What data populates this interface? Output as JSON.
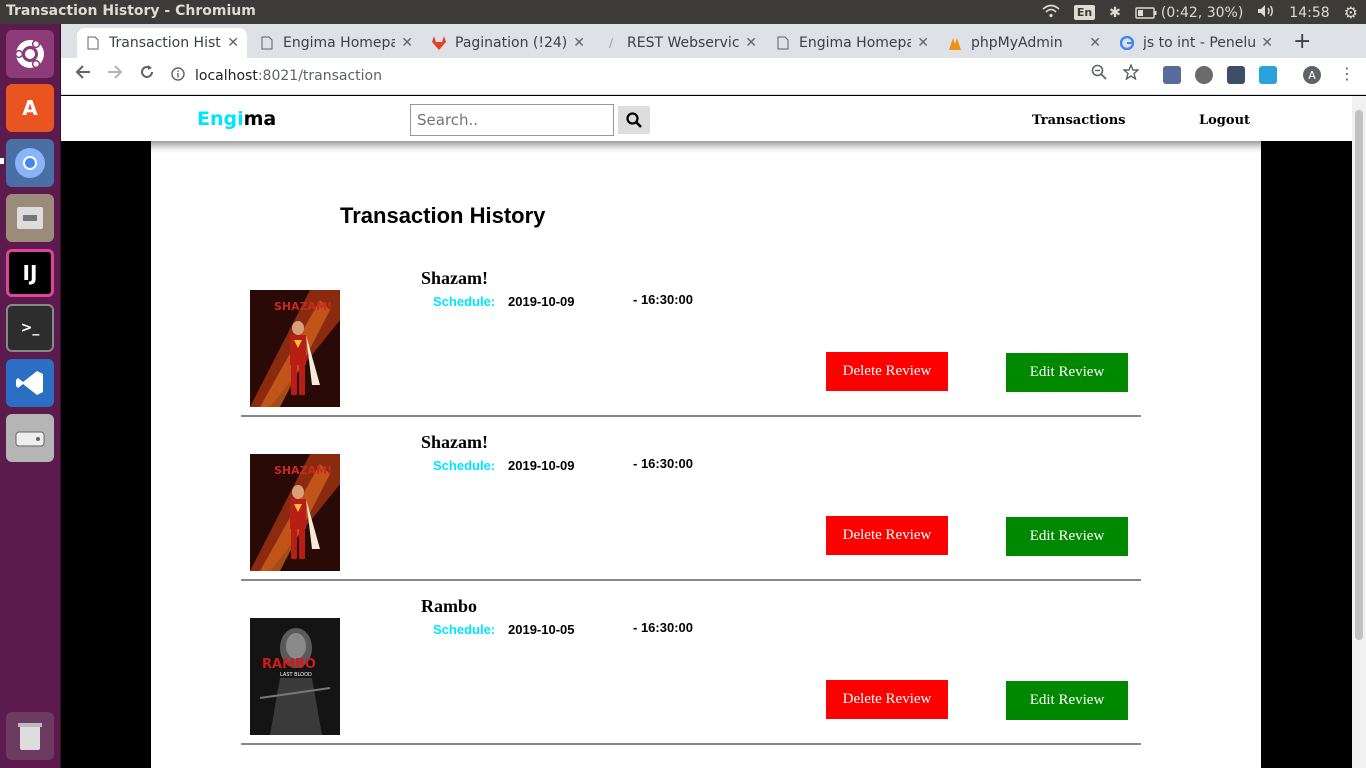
{
  "system": {
    "window_title": "Transaction History - Chromium",
    "lang": "En",
    "battery": "(0:42, 30%)",
    "clock": "14:58"
  },
  "browser": {
    "tabs": [
      {
        "label": "Transaction History",
        "icon": "page-icon",
        "active": true
      },
      {
        "label": "Engima Homepage",
        "icon": "page-icon",
        "active": false
      },
      {
        "label": "Pagination (!24)",
        "icon": "gitlab-icon",
        "active": false
      },
      {
        "label": "REST Webservice",
        "icon": "link-icon",
        "active": false
      },
      {
        "label": "Engima Homepage",
        "icon": "page-icon",
        "active": false
      },
      {
        "label": "phpMyAdmin",
        "icon": "phpmyadmin-icon",
        "active": false
      },
      {
        "label": "js to int - Penelusuran",
        "icon": "google-icon",
        "active": false
      }
    ],
    "url_host": "localhost",
    "url_path": ":8021/transaction",
    "profile_initial": "A"
  },
  "app": {
    "brand_part1": "Engi",
    "brand_part2": "ma",
    "search_placeholder": "Search..",
    "nav_transactions": "Transactions",
    "nav_logout": "Logout",
    "heading": "Transaction History",
    "schedule_label": "Schedule:",
    "delete_label": "Delete Review",
    "edit_label": "Edit Review",
    "transactions": [
      {
        "title": "Shazam!",
        "date": "2019-10-09",
        "time": "- 16:30:00",
        "poster": "shazam"
      },
      {
        "title": "Shazam!",
        "date": "2019-10-09",
        "time": "- 16:30:00",
        "poster": "shazam"
      },
      {
        "title": "Rambo",
        "date": "2019-10-05",
        "time": "- 16:30:00",
        "poster": "rambo"
      }
    ]
  },
  "colors": {
    "brand_cyan": "#00e5ff",
    "delete_red": "#ff0000",
    "edit_green": "#008800",
    "launcher_purple": "#5b1b4d"
  }
}
